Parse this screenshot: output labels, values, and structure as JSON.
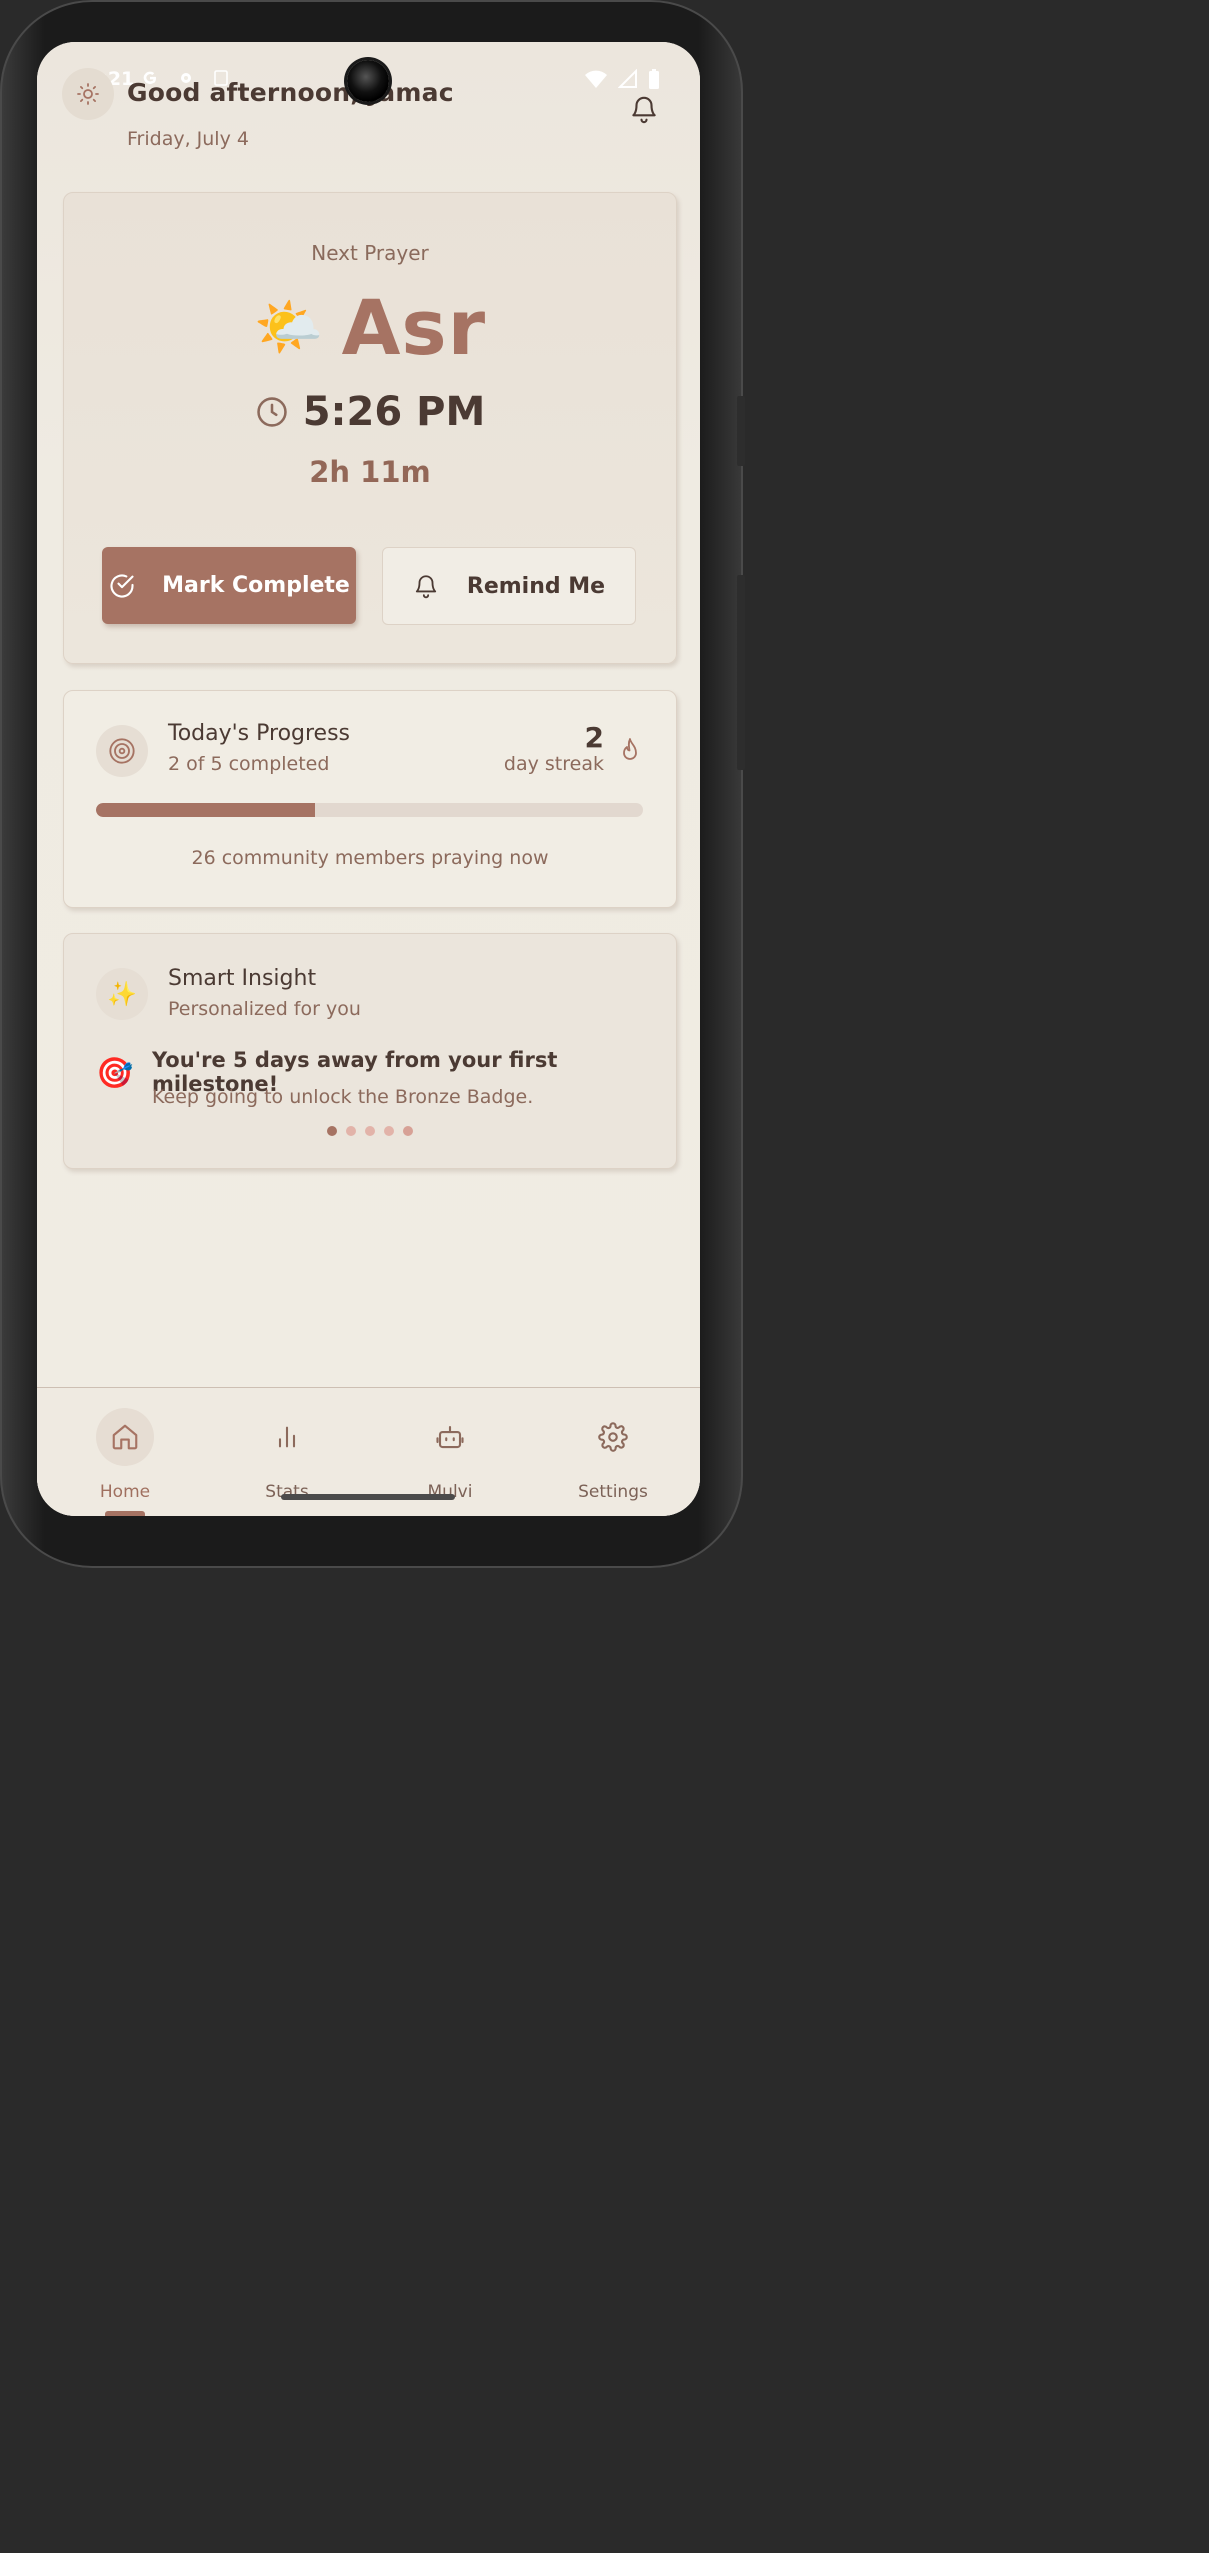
{
  "status_bar": {
    "time": "3:21"
  },
  "header": {
    "greeting": "Good afternoon, Jamac",
    "date": "Friday, July 4"
  },
  "next_prayer": {
    "label": "Next Prayer",
    "emoji": "🌤️",
    "name": "Asr",
    "time": "5:26 PM",
    "countdown": "2h 11m",
    "complete_label": "Mark Complete",
    "remind_label": "Remind Me"
  },
  "progress": {
    "title": "Today's Progress",
    "subtitle": "2 of 5 completed",
    "completed": 2,
    "total": 5,
    "fraction": 0.4,
    "streak_value": "2",
    "streak_label": "day streak",
    "community": "26 community members praying now"
  },
  "insight": {
    "icon_emoji": "✨",
    "title": "Smart Insight",
    "subtitle": "Personalized for you",
    "emoji": "🎯",
    "headline": "You're 5 days away from your first milestone!",
    "body": "Keep going to unlock the Bronze Badge.",
    "active_slide": 1,
    "slide_count": 5
  },
  "nav": {
    "items": [
      {
        "label": "Home",
        "icon": "home-icon",
        "active": true
      },
      {
        "label": "Stats",
        "icon": "bar-chart-icon",
        "active": false
      },
      {
        "label": "Mulvi",
        "icon": "robot-icon",
        "active": false
      },
      {
        "label": "Settings",
        "icon": "gear-icon",
        "active": false
      }
    ]
  },
  "colors": {
    "accent": "#a67363",
    "text_dark": "#4b3a33",
    "text_muted": "#8c6a5c",
    "background": "#efebe2"
  }
}
